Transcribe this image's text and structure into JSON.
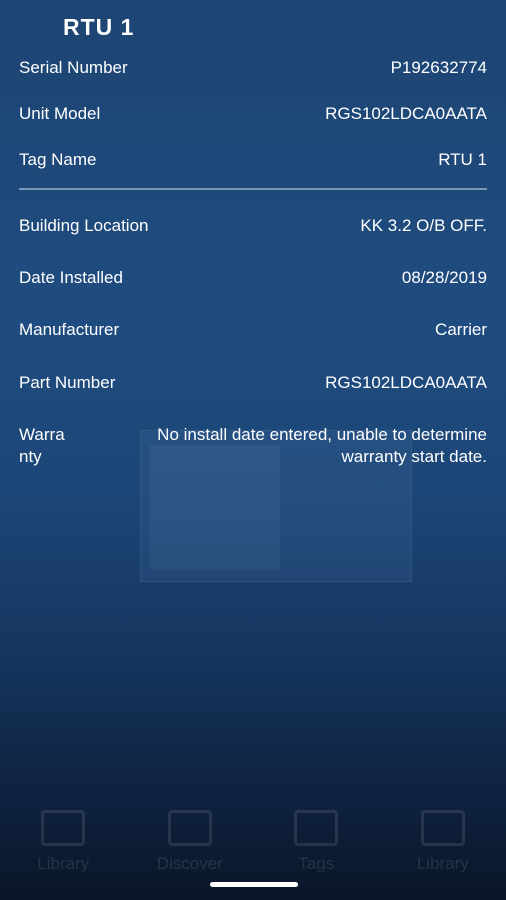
{
  "header": {
    "title": "RTU 1"
  },
  "details_top": [
    {
      "label": "Serial Number",
      "value": "P192632774"
    },
    {
      "label": "Unit Model",
      "value": "RGS102LDCA0AATA"
    },
    {
      "label": "Tag Name",
      "value": "RTU 1"
    }
  ],
  "details_bottom": [
    {
      "label": "Building Location",
      "value": "KK 3.2 O/B OFF."
    },
    {
      "label": "Date Installed",
      "value": "08/28/2019"
    },
    {
      "label": "Manufacturer",
      "value": "Carrier"
    },
    {
      "label": "Part Number",
      "value": "RGS102LDCA0AATA"
    }
  ],
  "warranty": {
    "label_line1": "Warra",
    "label_line2": "nty",
    "value_line1": "No install date entered, unable to determine",
    "value_line2": "warranty start date."
  },
  "bottom_nav": [
    {
      "label": "Library",
      "icon": "folder-icon"
    },
    {
      "label": "Discover",
      "icon": "scan-icon"
    },
    {
      "label": "Tags",
      "icon": "tag-icon"
    },
    {
      "label": "Library",
      "icon": "briefcase-icon"
    }
  ]
}
